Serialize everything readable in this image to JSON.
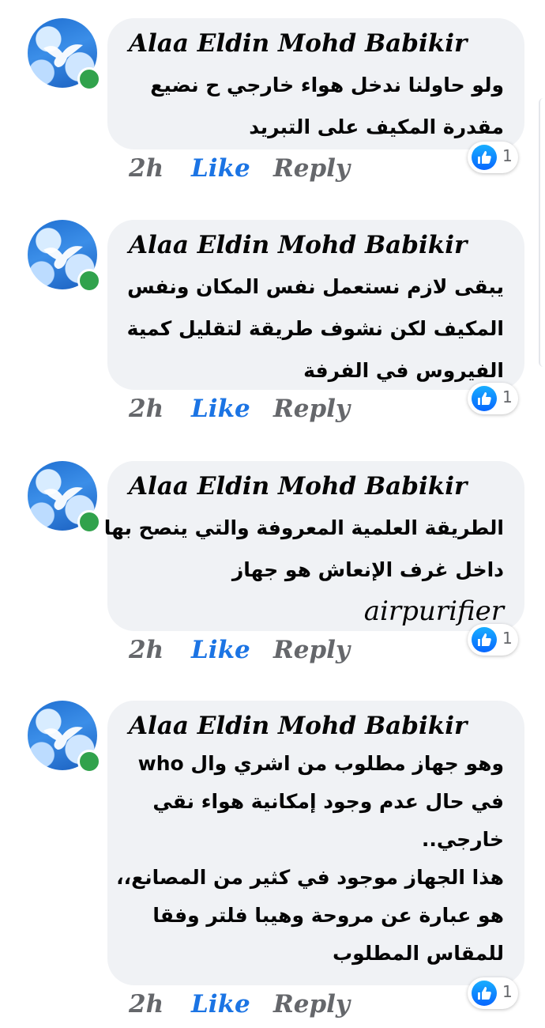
{
  "comments": [
    {
      "author": "Alaa Eldin Mohd Babikir",
      "lines": [
        "ولو حاولنا ندخل هواء خارجي ح نضيع",
        "مقدرة المكيف على التبريد"
      ],
      "time": "2h",
      "like_label": "Like",
      "reply_label": "Reply",
      "reaction_icon": "like-icon",
      "reaction_count": "1"
    },
    {
      "author": "Alaa Eldin Mohd Babikir",
      "lines": [
        "يبقى لازم نستعمل نفس المكان ونفس",
        "المكيف لكن نشوف طريقة لتقليل كمية",
        "الفيروس في الفرفة"
      ],
      "time": "2h",
      "like_label": "Like",
      "reply_label": "Reply",
      "reaction_icon": "like-icon",
      "reaction_count": "1"
    },
    {
      "author": "Alaa Eldin Mohd Babikir",
      "lines": [
        "الطريقة العلمية المعروفة والتي ينصح بها",
        "داخل غرف الإنعاش هو جهاز"
      ],
      "latin_line": "airpurifier",
      "time": "2h",
      "like_label": "Like",
      "reply_label": "Reply",
      "reaction_icon": "like-icon",
      "reaction_count": "1"
    },
    {
      "author": "Alaa Eldin Mohd Babikir",
      "lines": [
        "وهو جهاز مطلوب من اشري وال who",
        "في حال عدم وجود إمكانية هواء نقي",
        "خارجي..",
        "هذا الجهاز موجود في كثير من المصانع،،",
        "هو عبارة عن مروحة وهيبا فلتر وفقا",
        "للمقاس المطلوب"
      ],
      "time": "2h",
      "like_label": "Like",
      "reply_label": "Reply",
      "reaction_icon": "like-icon",
      "reaction_count": "1"
    }
  ],
  "colors": {
    "bubble": "#f0f2f5",
    "like_blue": "#1b74e4",
    "muted": "#65676b",
    "online": "#31a24c"
  },
  "avatar_icon": "dove-avatar-icon",
  "online_indicator": "online-status-icon"
}
